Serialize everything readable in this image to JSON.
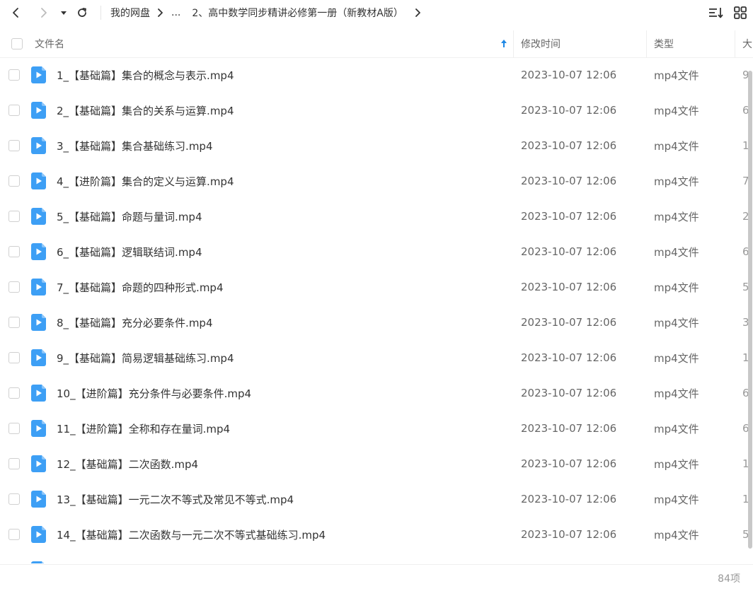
{
  "toolbar": {
    "back_icon": "chevron-left-icon",
    "forward_icon": "chevron-right-icon",
    "dropdown_icon": "caret-down-icon",
    "refresh_icon": "refresh-icon",
    "sort_icon": "sort-list-icon",
    "grid_icon": "grid-view-icon"
  },
  "breadcrumb": {
    "root": "我的网盘",
    "ellipsis": "...",
    "current": "2、高中数学同步精讲必修第一册（新教材A版）"
  },
  "header": {
    "name": "文件名",
    "modified": "修改时间",
    "type": "类型",
    "size": "大"
  },
  "files": [
    {
      "name": "1_【基础篇】集合的概念与表示.mp4",
      "modified": "2023-10-07 12:06",
      "type": "mp4文件",
      "size": "9"
    },
    {
      "name": "2_【基础篇】集合的关系与运算.mp4",
      "modified": "2023-10-07 12:06",
      "type": "mp4文件",
      "size": "6"
    },
    {
      "name": "3_【基础篇】集合基础练习.mp4",
      "modified": "2023-10-07 12:06",
      "type": "mp4文件",
      "size": "1"
    },
    {
      "name": "4_【进阶篇】集合的定义与运算.mp4",
      "modified": "2023-10-07 12:06",
      "type": "mp4文件",
      "size": "7"
    },
    {
      "name": "5_【基础篇】命题与量词.mp4",
      "modified": "2023-10-07 12:06",
      "type": "mp4文件",
      "size": "2"
    },
    {
      "name": "6_【基础篇】逻辑联结词.mp4",
      "modified": "2023-10-07 12:06",
      "type": "mp4文件",
      "size": "6"
    },
    {
      "name": "7_【基础篇】命题的四种形式.mp4",
      "modified": "2023-10-07 12:06",
      "type": "mp4文件",
      "size": "5"
    },
    {
      "name": "8_【基础篇】充分必要条件.mp4",
      "modified": "2023-10-07 12:06",
      "type": "mp4文件",
      "size": "3"
    },
    {
      "name": "9_【基础篇】简易逻辑基础练习.mp4",
      "modified": "2023-10-07 12:06",
      "type": "mp4文件",
      "size": "1"
    },
    {
      "name": "10_【进阶篇】充分条件与必要条件.mp4",
      "modified": "2023-10-07 12:06",
      "type": "mp4文件",
      "size": "6"
    },
    {
      "name": "11_【进阶篇】全称和存在量词.mp4",
      "modified": "2023-10-07 12:06",
      "type": "mp4文件",
      "size": "6"
    },
    {
      "name": "12_【基础篇】二次函数.mp4",
      "modified": "2023-10-07 12:06",
      "type": "mp4文件",
      "size": "1"
    },
    {
      "name": "13_【基础篇】一元二次不等式及常见不等式.mp4",
      "modified": "2023-10-07 12:06",
      "type": "mp4文件",
      "size": "1"
    },
    {
      "name": "14_【基础篇】二次函数与一元二次不等式基础练习.mp4",
      "modified": "2023-10-07 12:06",
      "type": "mp4文件",
      "size": "5"
    },
    {
      "name": "",
      "modified": "",
      "type": "",
      "size": ""
    }
  ],
  "footer": {
    "count": "84项"
  },
  "colors": {
    "accent": "#1e88e5",
    "file_icon": "#3d9ff5"
  }
}
